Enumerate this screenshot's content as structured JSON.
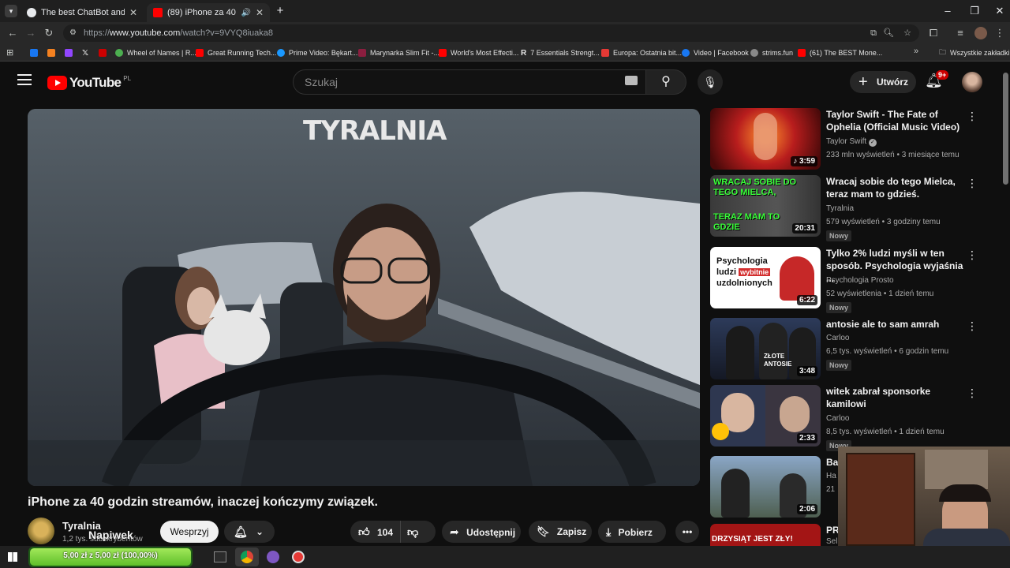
{
  "browser": {
    "tabs": [
      {
        "title": "The best ChatBot and Widgets",
        "active": false
      },
      {
        "title": "(89) iPhone za 40 godzin st",
        "active": true
      }
    ],
    "url_prefix": "https://",
    "url_host": "www.youtube.com",
    "url_path": "/watch?v=9VYQ8iuaka8",
    "bookmarks": [
      {
        "label": "",
        "color": "#1877f2"
      },
      {
        "label": "",
        "color": "#f48120"
      },
      {
        "label": "",
        "color": "#9146ff"
      },
      {
        "label": "",
        "color": "#ffffff"
      },
      {
        "label": "",
        "color": "#cc0000"
      },
      {
        "label": "Wheel of Names | R...",
        "color": "#4caf50"
      },
      {
        "label": "Great Running Tech...",
        "color": "#ff0000"
      },
      {
        "label": "Prime Video: Bękart...",
        "color": "#1a98ff"
      },
      {
        "label": "Marynarka Slim Fit -...",
        "color": "#8b1e3f"
      },
      {
        "label": "World's Most Effecti...",
        "color": "#ff0000"
      },
      {
        "label": "7 Essentials Strengt...",
        "color": "#dddddd"
      },
      {
        "label": "Europa: Ostatnia bit...",
        "color": "#e53935"
      },
      {
        "label": "Video | Facebook",
        "color": "#1877f2"
      },
      {
        "label": "strims.fun",
        "color": "#888888"
      },
      {
        "label": "(61) The BEST Mone...",
        "color": "#ff0000"
      }
    ],
    "all_bookmarks": "Wszystkie zakładki"
  },
  "youtube": {
    "logo": "YouTube",
    "region": "PL",
    "search_placeholder": "Szukaj",
    "create_label": "Utwórz",
    "notif_count": "9+"
  },
  "video": {
    "overlay_text": "TYRALNIA",
    "title": "iPhone za 40 godzin streamów, inaczej kończymy związek.",
    "channel": "Tyralnia",
    "subs": "1,2 tys. subskrybentów",
    "overlay_tip": "Napiwek",
    "support_label": "Wesprzyj",
    "likes": "104",
    "share_label": "Udostępnij",
    "save_label": "Zapisz",
    "download_label": "Pobierz"
  },
  "recommendations": [
    {
      "title": "Taylor Swift - The Fate of Ophelia (Official Music Video)",
      "channel": "Taylor Swift",
      "verified": true,
      "meta": "233 mln wyświetleń • 3 miesiące temu",
      "duration": "3:59",
      "new": false,
      "thumb_color": "#b81d1d"
    },
    {
      "title": "Wracaj sobie do tego Mielca, teraz mam to gdzieś.",
      "channel": "Tyralnia",
      "verified": false,
      "meta": "579 wyświetleń • 3 godziny temu",
      "duration": "20:31",
      "new": true,
      "thumb_color": "#2a2a2a"
    },
    {
      "title": "Tylko 2% ludzi myśli w ten sposób. Psychologia wyjaśnia ...",
      "channel": "Psychologia Prosto",
      "verified": false,
      "meta": "52 wyświetlenia • 1 dzień temu",
      "duration": "6:22",
      "new": true,
      "thumb_color": "#ffffff"
    },
    {
      "title": "antosie ale to sam amrah",
      "channel": "Carloo",
      "verified": false,
      "meta": "6,5 tys. wyświetleń • 6 godzin temu",
      "duration": "3:48",
      "new": true,
      "thumb_color": "#1f2536"
    },
    {
      "title": "witek zabrał sponsorke kamilowi",
      "channel": "Carloo",
      "verified": false,
      "meta": "8,5 tys. wyświetleń • 1 dzień temu",
      "duration": "2:33",
      "new": true,
      "thumb_color": "#2b3040"
    },
    {
      "title": "Ba",
      "channel": "Ha",
      "verified": false,
      "meta": "21",
      "duration": "2:06",
      "new": false,
      "thumb_color": "#5d7085"
    },
    {
      "title": "PR",
      "channel": "Sel",
      "verified": false,
      "meta": "",
      "duration": "",
      "new": false,
      "thumb_color": "#a31515"
    }
  ],
  "thumb_texts": {
    "mielec_top": "WRACAJ SOBIE DO TEGO MIELCA,",
    "mielec_bottom": "TERAZ MAM TO GDZIE",
    "psych_1": "Psychologia",
    "psych_2a": "ludzi ",
    "psych_2b": "wybitnie",
    "psych_3": "uzdolnionych",
    "antosie": "ZŁOTE ANTOSIE",
    "pr_text": "DRZYSIĄT JEST ZŁY!"
  },
  "taskbar": {
    "donation": "5,00 zł z 5,00 zł (100,00%)"
  }
}
